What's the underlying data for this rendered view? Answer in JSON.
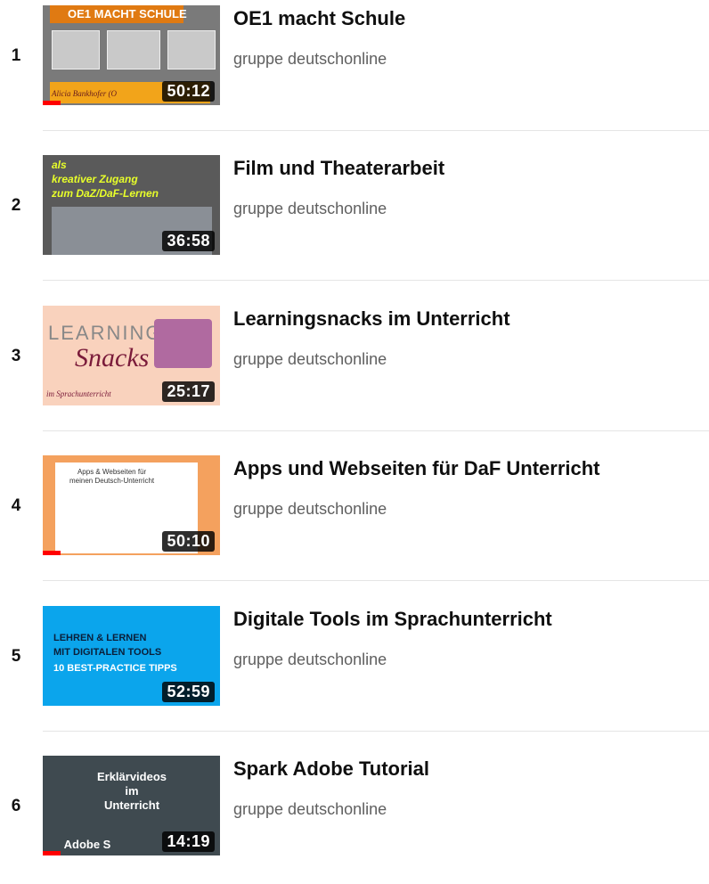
{
  "playlist": {
    "items": [
      {
        "index": "1",
        "title": "OE1 macht Schule",
        "channel": "gruppe deutschonline",
        "duration": "50:12",
        "watched_progress": 0.1,
        "thumb": {
          "banner": "OE1 MACHT SCHULE",
          "byline": "Alicia Bankhofer (O"
        }
      },
      {
        "index": "2",
        "title": "Film und Theaterarbeit",
        "channel": "gruppe deutschonline",
        "duration": "36:58",
        "watched_progress": 0,
        "thumb": {
          "line1": "als",
          "line2": "kreativer Zugang",
          "line3": "zum DaZ/DaF-Lernen"
        }
      },
      {
        "index": "3",
        "title": "Learningsnacks im Unterricht",
        "channel": "gruppe deutschonline",
        "duration": "25:17",
        "watched_progress": 0,
        "thumb": {
          "word1": "LEARNING",
          "word2": "Snacks",
          "tiny": "im Sprachunterricht"
        }
      },
      {
        "index": "4",
        "title": "Apps und Webseiten für DaF Unterricht",
        "channel": "gruppe deutschonline",
        "duration": "50:10",
        "watched_progress": 0.1,
        "thumb": {
          "cap1": "Apps & Webseiten für",
          "cap2": "meinen Deutsch-Unterricht"
        }
      },
      {
        "index": "5",
        "title": "Digitale Tools im Sprachunterricht",
        "channel": "gruppe deutschonline",
        "duration": "52:59",
        "watched_progress": 0,
        "thumb": {
          "l1": "LEHREN & LERNEN",
          "l2": "MIT DIGITALEN TOOLS",
          "l3": "10 BEST-PRACTICE TIPPS"
        }
      },
      {
        "index": "6",
        "title": "Spark Adobe Tutorial",
        "channel": "gruppe deutschonline",
        "duration": "14:19",
        "watched_progress": 0.1,
        "thumb": {
          "l1": "Erklärvideos",
          "l2": "im",
          "l3": "Unterricht",
          "l4": "Adobe S"
        }
      }
    ]
  },
  "colors": {
    "progress": "#ff0000",
    "channel": "#606060",
    "divider": "#e5e5e5"
  }
}
